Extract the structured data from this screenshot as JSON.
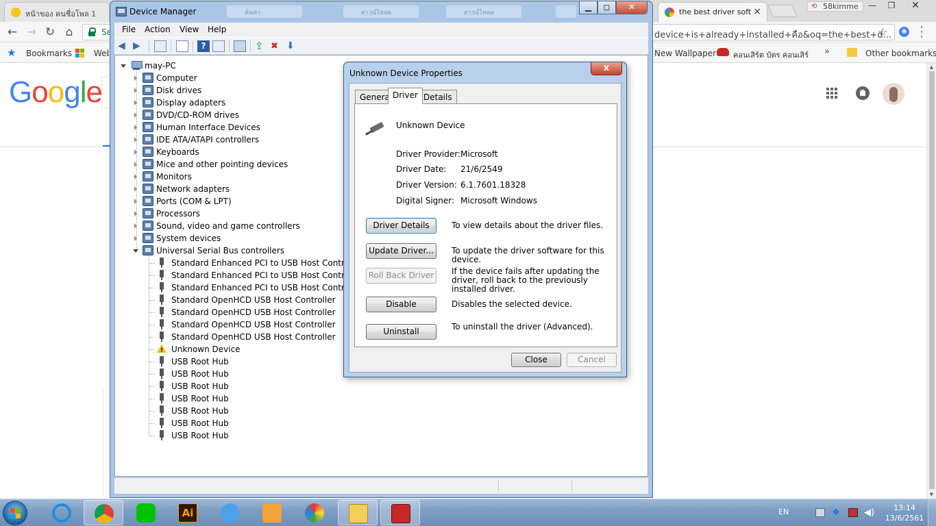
{
  "chrome": {
    "tabs": [
      {
        "title": "หน้าของ คนชื่อโพล 1"
      },
      {
        "title": "the best driver soft"
      }
    ],
    "close_glyph": "×",
    "profile": "58kimme",
    "omnibox": {
      "secure_label": "Se",
      "url_fragment": "device+is+already+installed+คือ&oq=the+best+d..."
    },
    "bookmarks": {
      "bookmarks_label": "Bookmarks",
      "web_label": "Web",
      "wallpaper_label": "New Wallpaper",
      "concert_label": "คอนเสิร์ต บัตร คอนเสิร์",
      "more_glyph": "»",
      "other_label": "Other bookmarks"
    }
  },
  "google": {
    "logo_letters": [
      "G",
      "o",
      "o",
      "g",
      "l",
      "e"
    ],
    "logo_colors": [
      "#4285F4",
      "#EA4335",
      "#FBBC05",
      "#4285F4",
      "#34A853",
      "#EA4335"
    ]
  },
  "device_manager": {
    "title": "Device Manager",
    "ghost_tabs": [
      "ค้นหา",
      "ดาวน์โหลด",
      "ดาวน์โหลด",
      ""
    ],
    "menus": [
      "File",
      "Action",
      "View",
      "Help"
    ],
    "root": "may-PC",
    "categories": [
      {
        "label": "Computer",
        "icon": "computer-icon"
      },
      {
        "label": "Disk drives",
        "icon": "disk-drive-icon"
      },
      {
        "label": "Display adapters",
        "icon": "display-adapter-icon"
      },
      {
        "label": "DVD/CD-ROM drives",
        "icon": "dvd-drive-icon"
      },
      {
        "label": "Human Interface Devices",
        "icon": "hid-icon"
      },
      {
        "label": "IDE ATA/ATAPI controllers",
        "icon": "ide-controller-icon"
      },
      {
        "label": "Keyboards",
        "icon": "keyboard-icon"
      },
      {
        "label": "Mice and other pointing devices",
        "icon": "mouse-icon"
      },
      {
        "label": "Monitors",
        "icon": "monitor-icon"
      },
      {
        "label": "Network adapters",
        "icon": "network-adapter-icon"
      },
      {
        "label": "Ports (COM & LPT)",
        "icon": "port-icon"
      },
      {
        "label": "Processors",
        "icon": "processor-icon"
      },
      {
        "label": "Sound, video and game controllers",
        "icon": "sound-icon"
      },
      {
        "label": "System devices",
        "icon": "system-device-icon"
      },
      {
        "label": "Universal Serial Bus controllers",
        "icon": "usb-icon"
      }
    ],
    "usb_children": [
      {
        "label": "Standard Enhanced PCI to USB Host Controller",
        "warning": false
      },
      {
        "label": "Standard Enhanced PCI to USB Host Controller",
        "warning": false
      },
      {
        "label": "Standard Enhanced PCI to USB Host Controller",
        "warning": false
      },
      {
        "label": "Standard OpenHCD USB Host Controller",
        "warning": false
      },
      {
        "label": "Standard OpenHCD USB Host Controller",
        "warning": false
      },
      {
        "label": "Standard OpenHCD USB Host Controller",
        "warning": false
      },
      {
        "label": "Standard OpenHCD USB Host Controller",
        "warning": false
      },
      {
        "label": "Unknown Device",
        "warning": true
      },
      {
        "label": "USB Root Hub",
        "warning": false
      },
      {
        "label": "USB Root Hub",
        "warning": false
      },
      {
        "label": "USB Root Hub",
        "warning": false
      },
      {
        "label": "USB Root Hub",
        "warning": false
      },
      {
        "label": "USB Root Hub",
        "warning": false
      },
      {
        "label": "USB Root Hub",
        "warning": false
      },
      {
        "label": "USB Root Hub",
        "warning": false
      }
    ]
  },
  "properties": {
    "title": "Unknown Device Properties",
    "close_glyph": "x",
    "tabs": [
      "General",
      "Driver",
      "Details"
    ],
    "active_tab": "Driver",
    "device_name": "Unknown Device",
    "info": [
      {
        "label": "Driver Provider:",
        "value": "Microsoft"
      },
      {
        "label": "Driver Date:",
        "value": "21/6/2549"
      },
      {
        "label": "Driver Version:",
        "value": "6.1.7601.18328"
      },
      {
        "label": "Digital Signer:",
        "value": "Microsoft Windows"
      }
    ],
    "actions": [
      {
        "label": "Driver Details",
        "desc": "To view details about the driver files.",
        "enabled": true
      },
      {
        "label": "Update Driver...",
        "desc": "To update the driver software for this device.",
        "enabled": true
      },
      {
        "label": "Roll Back Driver",
        "desc": "If the device fails after updating the driver, roll back to the previously installed driver.",
        "enabled": false
      },
      {
        "label": "Disable",
        "desc": "Disables the selected device.",
        "enabled": true
      },
      {
        "label": "Uninstall",
        "desc": "To uninstall the driver (Advanced).",
        "enabled": true
      }
    ],
    "close_label": "Close",
    "cancel_label": "Cancel"
  },
  "taskbar": {
    "apps": [
      {
        "name": "internet-explorer-icon",
        "open": false
      },
      {
        "name": "chrome-icon",
        "open": true
      },
      {
        "name": "line-icon",
        "open": false
      },
      {
        "name": "illustrator-icon",
        "open": false,
        "text": "Ai"
      },
      {
        "name": "bird-app-icon",
        "open": false
      },
      {
        "name": "media-player-icon",
        "open": false
      },
      {
        "name": "paint-icon",
        "open": false
      },
      {
        "name": "file-explorer-icon",
        "open": true
      },
      {
        "name": "toolbox-icon",
        "open": true
      }
    ],
    "language": "EN",
    "time": "13:14",
    "date": "13/6/2561"
  }
}
